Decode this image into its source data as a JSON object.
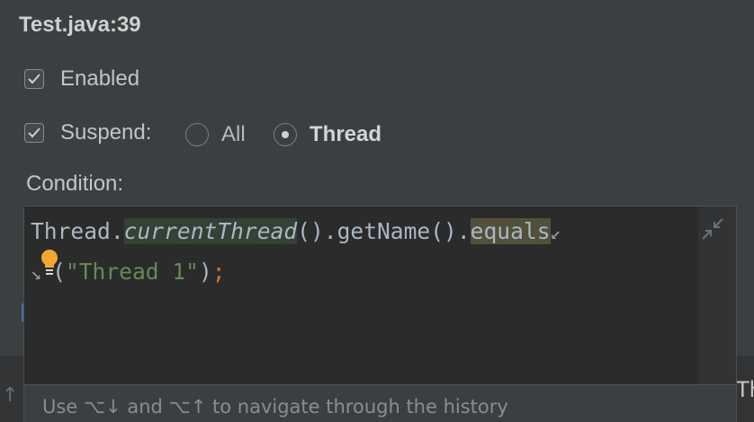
{
  "title": "Test.java:39",
  "enabled": {
    "label": "Enabled",
    "checked": true
  },
  "suspend": {
    "label": "Suspend:",
    "checked": true,
    "options": [
      {
        "label": "All",
        "selected": false
      },
      {
        "label": "Thread",
        "selected": true
      }
    ]
  },
  "condition": {
    "label": "Condition:",
    "code": {
      "part1": "Thread.",
      "method1": "currentThread",
      "part2": "().getName().",
      "method2": "equals",
      "line2_open": "(",
      "string": "\"Thread 1\"",
      "line2_close": ")",
      "semicolon": ";"
    }
  },
  "footer": {
    "hint": "Use ⌥↓ and ⌥↑ to navigate through the history"
  },
  "clipped": {
    "left_arrow": "↑",
    "right_text": "Th"
  },
  "colors": {
    "background": "#3c3f41",
    "editor_bg": "#2b2b2b",
    "string": "#6a8759",
    "keyword": "#cc7832",
    "bulb": "#f0a732"
  }
}
